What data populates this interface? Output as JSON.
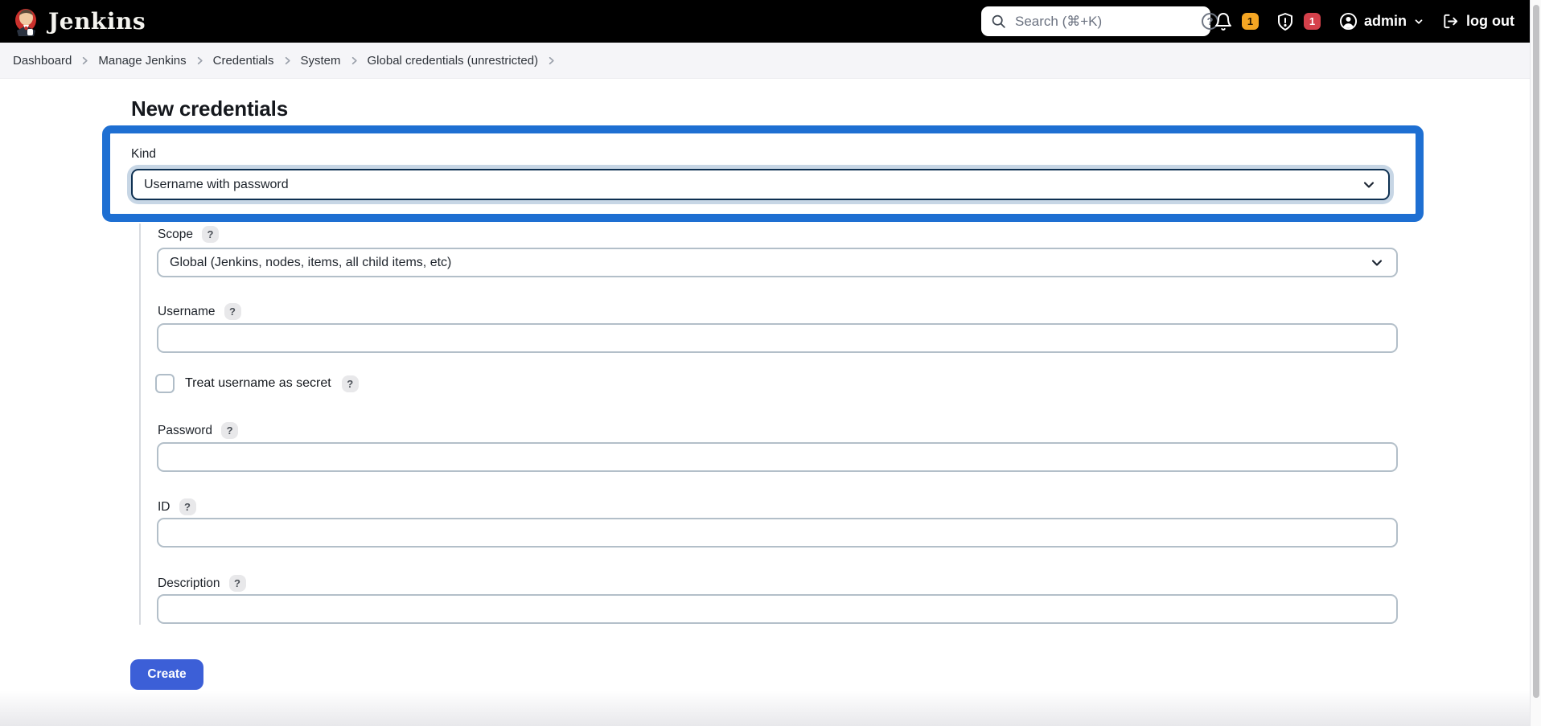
{
  "header": {
    "brand": "Jenkins",
    "search_placeholder": "Search (⌘+K)",
    "bell_badge": "1",
    "security_badge": "1",
    "user_name": "admin",
    "logout_label": "log out"
  },
  "breadcrumb": {
    "items": [
      "Dashboard",
      "Manage Jenkins",
      "Credentials",
      "System",
      "Global credentials (unrestricted)"
    ]
  },
  "page": {
    "title": "New credentials"
  },
  "form": {
    "kind_label": "Kind",
    "kind_value": "Username with password",
    "scope_label": "Scope",
    "scope_value": "Global (Jenkins, nodes, items, all child items, etc)",
    "username_label": "Username",
    "username_value": "",
    "treat_secret_label": "Treat username as secret",
    "treat_secret_checked": false,
    "password_label": "Password",
    "password_value": "",
    "id_label": "ID",
    "id_value": "",
    "description_label": "Description",
    "description_value": "",
    "help_symbol": "?",
    "create_label": "Create"
  },
  "colors": {
    "highlight_border": "#1E6FD2",
    "primary_button": "#3C5FD7",
    "bell_badge_bg": "#F5A623",
    "security_badge_bg": "#D5414B",
    "header_bg": "#000000",
    "breadcrumb_bg": "#F5F5F8"
  }
}
